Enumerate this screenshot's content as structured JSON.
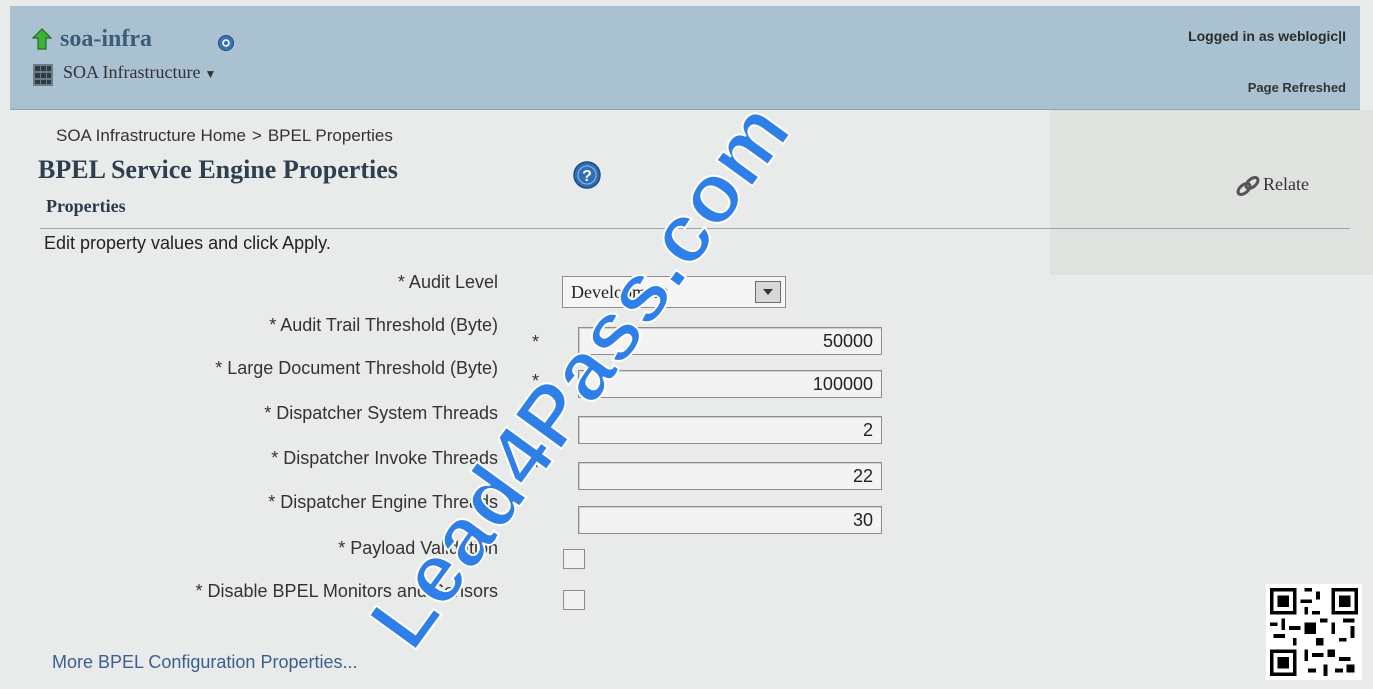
{
  "header": {
    "app_title": "soa-infra",
    "menu_label": "SOA Infrastructure",
    "logged_in": "Logged in as  weblogic|I",
    "page_refreshed": "Page Refreshed"
  },
  "breadcrumb": {
    "home": "SOA Infrastructure Home",
    "separator": ">",
    "current": "BPEL Properties"
  },
  "page": {
    "title": "BPEL Service Engine Properties",
    "relate_label": "Relate",
    "section_title": "Properties",
    "instructions": "Edit property values and click Apply."
  },
  "form": {
    "audit_level": {
      "label": "* Audit Level",
      "value": "Development"
    },
    "audit_trail_threshold": {
      "label": "* Audit Trail Threshold (Byte)",
      "value": "50000"
    },
    "large_document_threshold": {
      "label": "* Large Document Threshold (Byte)",
      "value": "100000"
    },
    "dispatcher_system_threads": {
      "label": "* Dispatcher System Threads",
      "value": "2"
    },
    "dispatcher_invoke_threads": {
      "label": "* Dispatcher Invoke Threads",
      "value": "22"
    },
    "dispatcher_engine_threads": {
      "label": "* Dispatcher Engine Threads",
      "value": "30"
    },
    "payload_validation": {
      "label": "* Payload Validation",
      "checked": false
    },
    "disable_monitors": {
      "label": "* Disable BPEL Monitors and Sensors",
      "checked": false
    },
    "required_mark": "*"
  },
  "links": {
    "more_config": "More BPEL Configuration Properties..."
  },
  "watermark": "Lead4Pass.com",
  "colors": {
    "header_bg": "#a9c1d0",
    "page_bg": "#e9eaea",
    "link": "#3a5f90",
    "watermark": "#2f7fe8"
  }
}
